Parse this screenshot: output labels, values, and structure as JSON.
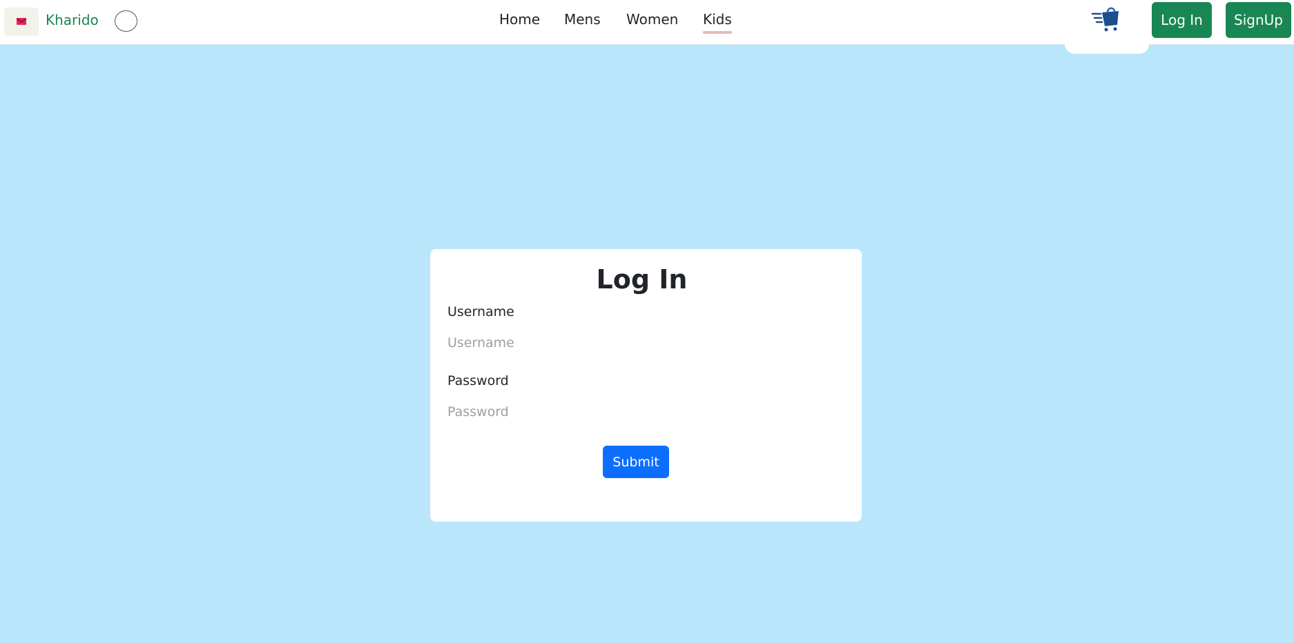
{
  "navbar": {
    "brand_name": "Kharido",
    "links": [
      {
        "label": "Home"
      },
      {
        "label": "Mens"
      },
      {
        "label": "Women"
      },
      {
        "label": "Kids",
        "active": true
      }
    ],
    "login_label": "Log In",
    "signup_label": "SignUp",
    "accent_color": "#198754",
    "cart_icon": "shopping-cart-icon",
    "theme_icon": "circle-toggle-icon",
    "logo_icon": "envelope-logo-icon"
  },
  "login_form": {
    "title": "Log In",
    "username_label": "Username",
    "username_placeholder": "Username",
    "username_value": "",
    "password_label": "Password",
    "password_placeholder": "Password",
    "password_value": "",
    "submit_label": "Submit",
    "submit_color": "#0d6efd"
  },
  "colors": {
    "background": "#bae6fc"
  }
}
